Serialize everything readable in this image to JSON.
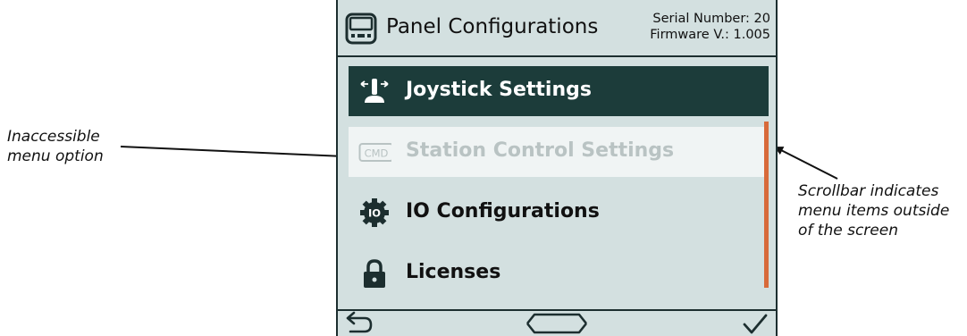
{
  "header": {
    "title": "Panel Configurations",
    "serial_label": "Serial Number: 20",
    "firmware_label": "Firmware V.: 1.005",
    "icon": "control-panel-icon"
  },
  "menu": {
    "items": [
      {
        "label": "Joystick Settings",
        "icon": "joystick-icon",
        "state": "selected"
      },
      {
        "label": "Station Control Settings",
        "icon": "cmd-icon",
        "icon_text": "CMD",
        "state": "disabled"
      },
      {
        "label": "IO Configurations",
        "icon": "io-gear-icon",
        "icon_text": "IO",
        "state": "normal"
      },
      {
        "label": "Licenses",
        "icon": "lock-icon",
        "state": "normal"
      }
    ]
  },
  "footer": {
    "back": "back-arrow-icon",
    "navigate": "navigate-icon",
    "confirm": "checkmark-icon"
  },
  "annotations": {
    "left_line1": "Inaccessible",
    "left_line2": "menu option",
    "right_line1": "Scrollbar indicates",
    "right_line2": "menu items outside",
    "right_line3": "of the screen"
  },
  "colors": {
    "selected_bg": "#1c3c3a",
    "item_bg": "#d3e0e0",
    "disabled_bg": "#f0f4f4",
    "disabled_text": "#b9c3c3",
    "scrollbar": "#d86a3a",
    "frame": "#1c2e2f"
  }
}
